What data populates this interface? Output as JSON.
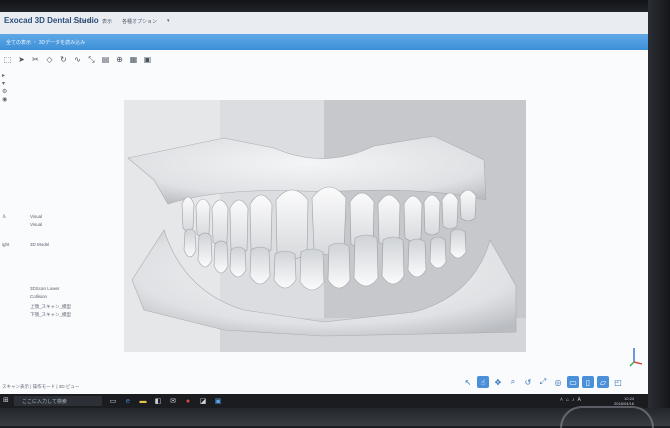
{
  "app": {
    "title": "Exocad 3D Dental Studio",
    "menu": [
      "ファイル",
      "表示",
      "各種オプション",
      "▾"
    ]
  },
  "ribbon": {
    "text": "全ての表示 ・ 3Dデータを読み込み"
  },
  "toolbar": {
    "buttons": [
      {
        "name": "select-icon",
        "glyph": "⬚"
      },
      {
        "name": "arrow-icon",
        "glyph": "➤"
      },
      {
        "name": "cut-icon",
        "glyph": "✂"
      },
      {
        "name": "shape-icon",
        "glyph": "◇"
      },
      {
        "name": "rotate-icon",
        "glyph": "↻"
      },
      {
        "name": "curve-icon",
        "glyph": "∿"
      },
      {
        "name": "move-icon",
        "glyph": "⤡"
      },
      {
        "name": "layers-icon",
        "glyph": "▤"
      },
      {
        "name": "target-icon",
        "glyph": "⊕"
      },
      {
        "name": "grid-icon",
        "glyph": "▦"
      },
      {
        "name": "box-icon",
        "glyph": "▣"
      }
    ]
  },
  "left_panel": {
    "properties": [
      {
        "key": "ル",
        "value": "Visual"
      },
      {
        "key": "",
        "value": "Visual"
      },
      {
        "key": "ight",
        "value": "3D Model"
      },
      {
        "key": "",
        "value": ""
      },
      {
        "key": "",
        "value": "3DScan Lower"
      },
      {
        "key": "",
        "value": "Collision"
      },
      {
        "key": "",
        "value": "上顎_スキャン_模型"
      },
      {
        "key": "",
        "value": "下顎_スキャン_模型"
      }
    ]
  },
  "status": {
    "text": "スキャン表示 | 操作モード | 3D ビュー"
  },
  "viewbar": {
    "buttons": [
      {
        "name": "cursor-icon",
        "glyph": "↖",
        "active": false
      },
      {
        "name": "pointer-icon",
        "glyph": "☝",
        "active": true
      },
      {
        "name": "pan-icon",
        "glyph": "✥",
        "active": false
      },
      {
        "name": "zoom-icon",
        "glyph": "⌕",
        "active": false
      },
      {
        "name": "rotate-view-icon",
        "glyph": "↺",
        "active": false
      },
      {
        "name": "fit-icon",
        "glyph": "⤢",
        "active": false
      },
      {
        "name": "camera-icon",
        "glyph": "◎",
        "active": false
      },
      {
        "name": "front-view-icon",
        "glyph": "▭",
        "active": true
      },
      {
        "name": "side-view-icon",
        "glyph": "▯",
        "active": true
      },
      {
        "name": "top-view-icon",
        "glyph": "▱",
        "active": true
      },
      {
        "name": "perspective-icon",
        "glyph": "◰",
        "active": false
      }
    ]
  },
  "taskbar": {
    "search_placeholder": "ここに入力して検索",
    "time": "10:24",
    "date": "2018/04/16"
  },
  "colors": {
    "ribbon": "#3d8fd6",
    "accent": "#4a90d9"
  }
}
